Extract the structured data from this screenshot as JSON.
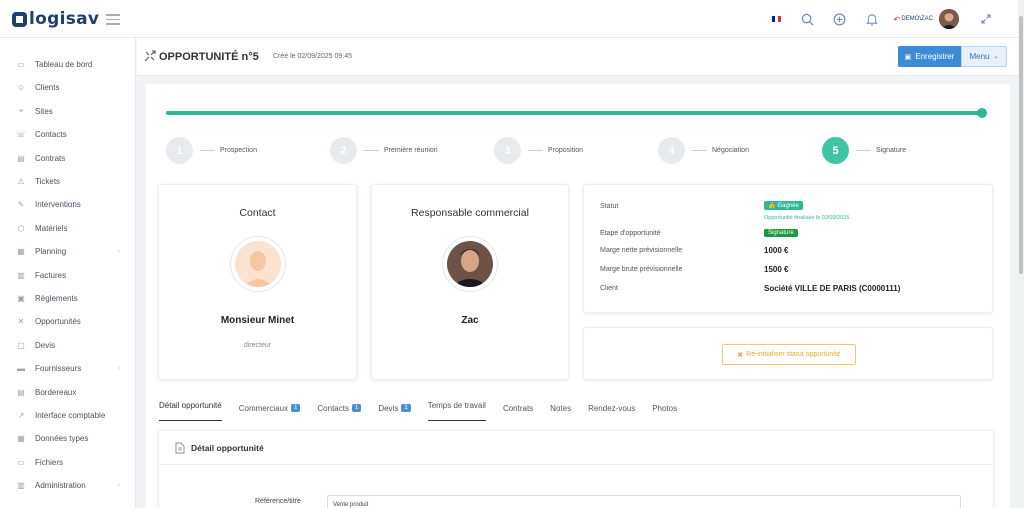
{
  "app": {
    "logo_text": "logisav"
  },
  "topbar": {
    "flag_colors": [
      "#002395",
      "#ffffff",
      "#ed2939"
    ],
    "icons": [
      "search-icon",
      "plus-circle-icon",
      "bell-icon",
      "expand-icon"
    ],
    "user_label": "DEMO\\ZAC"
  },
  "sidebar": {
    "items": [
      {
        "label": "Tableau de bord",
        "icon": "dashboard-icon",
        "has_children": false
      },
      {
        "label": "Clients",
        "icon": "users-icon",
        "has_children": false
      },
      {
        "label": "Sites",
        "icon": "location-icon",
        "has_children": false
      },
      {
        "label": "Contacts",
        "icon": "contacts-icon",
        "has_children": false
      },
      {
        "label": "Contrats",
        "icon": "contract-icon",
        "has_children": false
      },
      {
        "label": "Tickets",
        "icon": "warning-icon",
        "has_children": false
      },
      {
        "label": "Interventions",
        "icon": "wrench-icon",
        "has_children": false
      },
      {
        "label": "Matériels",
        "icon": "box-icon",
        "has_children": false
      },
      {
        "label": "Planning",
        "icon": "calendar-icon",
        "has_children": true
      },
      {
        "label": "Factures",
        "icon": "invoice-icon",
        "has_children": false
      },
      {
        "label": "Règlements",
        "icon": "payment-icon",
        "has_children": false
      },
      {
        "label": "Opportunités",
        "icon": "opportunity-icon",
        "has_children": false
      },
      {
        "label": "Devis",
        "icon": "quote-icon",
        "has_children": false
      },
      {
        "label": "Fournisseurs",
        "icon": "truck-icon",
        "has_children": true
      },
      {
        "label": "Bordereaux",
        "icon": "slip-icon",
        "has_children": false
      },
      {
        "label": "Interface comptable",
        "icon": "external-link-icon",
        "has_children": false
      },
      {
        "label": "Données types",
        "icon": "data-icon",
        "has_children": false
      },
      {
        "label": "Fichiers",
        "icon": "folder-icon",
        "has_children": false
      },
      {
        "label": "Administration",
        "icon": "admin-icon",
        "has_children": true
      }
    ]
  },
  "header": {
    "title": "OPPORTUNITÉ n°5",
    "created": "Créé le 02/09/2025 09:45",
    "save_label": "Enregistrer",
    "menu_label": "Menu"
  },
  "progress": {
    "fraction": 1.0
  },
  "steps": [
    {
      "number": "1",
      "label": "Prospection",
      "active": false
    },
    {
      "number": "2",
      "label": "Première réunion",
      "active": false
    },
    {
      "number": "3",
      "label": "Proposition",
      "active": false
    },
    {
      "number": "4",
      "label": "Négociation",
      "active": false
    },
    {
      "number": "5",
      "label": "Signature",
      "active": true
    }
  ],
  "contact_card": {
    "title": "Contact",
    "name": "Monsieur Minet",
    "role": "directeur"
  },
  "sales_card": {
    "title": "Responsable commercial",
    "name": "Zac"
  },
  "info": {
    "statut_label": "Statut",
    "statut_value": "Gagnée",
    "statut_note": "Opportunité finalisée le 02/09/2025",
    "etape_label": "Etape d'opportunité",
    "etape_value": "Signature",
    "marge_nette_label": "Marge nette prévisionnelle",
    "marge_nette_value": "1000 €",
    "marge_brute_label": "Marge brute prévisionnelle",
    "marge_brute_value": "1500 €",
    "client_label": "Client",
    "client_value": "Société VILLE DE PARIS (C0000111)"
  },
  "reinit_label": "Ré-initialiser statut opportunité",
  "tabs": [
    {
      "label": "Détail opportunité",
      "count": "",
      "state": "active"
    },
    {
      "label": "Commerciaux",
      "count": "1",
      "state": ""
    },
    {
      "label": "Contacts",
      "count": "1",
      "state": ""
    },
    {
      "label": "Devis",
      "count": "1",
      "state": ""
    },
    {
      "label": "Temps de travail",
      "count": "",
      "state": "underlined"
    },
    {
      "label": "Contrats",
      "count": "",
      "state": ""
    },
    {
      "label": "Notes",
      "count": "",
      "state": ""
    },
    {
      "label": "Rendez-vous",
      "count": "",
      "state": ""
    },
    {
      "label": "Photos",
      "count": "",
      "state": ""
    }
  ],
  "detail": {
    "title": "Détail opportunité",
    "reference_label": "Référence/titre",
    "reference_value": "Vente produit"
  }
}
